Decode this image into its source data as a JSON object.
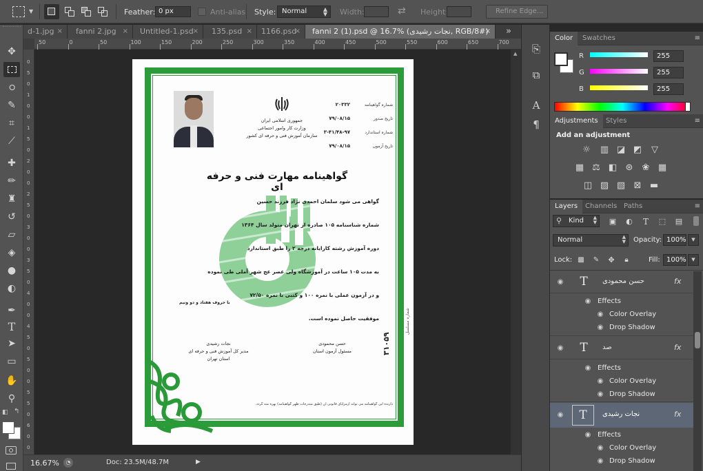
{
  "options": {
    "feather_label": "Feather:",
    "feather_value": "0 px",
    "antialias_label": "Anti-alias",
    "style_label": "Style:",
    "style_value": "Normal",
    "width_label": "Width:",
    "height_label": "Height:",
    "refine_label": "Refine Edge..."
  },
  "tabs": [
    {
      "label": "d-1.jpg"
    },
    {
      "label": "fanni 2.jpg"
    },
    {
      "label": "Untitled-1.psd"
    },
    {
      "label": "135.psd"
    },
    {
      "label": "1166.psd"
    },
    {
      "label": "fanni 2 (1).psd @ 16.7% (نجات رشیدی, RGB/8#)"
    }
  ],
  "tab_overflow": "»",
  "tab_close": "×",
  "ruler": {
    "h": [
      "50",
      "0",
      "50",
      "100",
      "150",
      "200",
      "250",
      "300",
      "350",
      "400",
      "450",
      "500",
      "550",
      "600",
      "650",
      "700"
    ],
    "v": [
      "0",
      "5",
      "0",
      "1",
      "0",
      "0",
      "1",
      "5",
      "0",
      "2",
      "0",
      "0",
      "2",
      "5",
      "0",
      "3",
      "0",
      "0",
      "3",
      "5",
      "0",
      "4",
      "0",
      "0",
      "4",
      "5",
      "0",
      "5",
      "0",
      "0",
      "5",
      "5",
      "0",
      "6",
      "0",
      "0"
    ]
  },
  "status": {
    "zoom": "16.67%",
    "doc": "Doc: 23.5M/48.7M"
  },
  "color_panel": {
    "tabs": [
      "Color",
      "Swatches"
    ],
    "channels": [
      {
        "label": "R",
        "value": "255"
      },
      {
        "label": "G",
        "value": "255"
      },
      {
        "label": "B",
        "value": "255"
      }
    ],
    "colors": {
      "r": "#ff0000",
      "g": "#00ff00",
      "b": "#0000ff"
    }
  },
  "adjustments_panel": {
    "tabs": [
      "Adjustments",
      "Styles"
    ],
    "heading": "Add an adjustment"
  },
  "layers_panel": {
    "tabs": [
      "Layers",
      "Channels",
      "Paths"
    ],
    "filter_label": "Kind",
    "blend_mode": "Normal",
    "opacity_label": "Opacity:",
    "opacity_value": "100%",
    "lock_label": "Lock:",
    "fill_label": "Fill:",
    "fill_value": "100%",
    "layers": [
      {
        "name": "حسن محمودی",
        "fx": "fx",
        "effects": "Effects",
        "effect1": "Color Overlay",
        "effect2": "Drop Shadow"
      },
      {
        "name": "صد",
        "fx": "fx",
        "effects": "Effects",
        "effect1": "Color Overlay",
        "effect2": "Drop Shadow"
      },
      {
        "name": "نجات رشیدی",
        "fx": "fx",
        "effects": "Effects",
        "effect1": "Color Overlay",
        "effect2": "Drop Shadow"
      }
    ]
  },
  "certificate": {
    "header_right": [
      "جمهوری اسلامی ایران",
      "وزارت کار وامور اجتماعی",
      "سازمان آموزش فنی و حرفه ای کشور"
    ],
    "meta_labels": [
      "شماره گواهینامه",
      "تاریخ صدور",
      "شماره استاندارد",
      "تاریخ آزمون"
    ],
    "meta_values": [
      "۲۰۳۳۲",
      "۷۹/۰۸/۱۵",
      "۳-۴۱/۴۸-۹۷",
      "۷۹/۰۸/۱۵"
    ],
    "title": "گواهینامه مهارت فنی و حرفه ای",
    "line1": "گواهی می شود     سلمان احمدی نژاد     فرزند     حسین",
    "line2": "شماره شناسنامه   ۱۰۵   صادره از   تهران   متولد سال   ۱۳۶۴",
    "line3": "دوره آموزش رشته   کارایانه درجه ۲   را طبق استاندارد",
    "line4": "به مدت  ۱۰۵  ساعت در  آموزشگاه  ولی عصر عج  شهر  آملی  طی نموده",
    "line5": "و در آزمون عملی با نمره  ۱۰۰  و کتبی با نمره  ۷۲/۵۰",
    "line5b": "با حروف  هفتاد و دو ونیم",
    "line6": "موفقیت حاصل نموده است.",
    "sign_left_name": "نجات رشیدی",
    "sign_left_title": "مدیر کل آموزش فنی و حرفه ای",
    "sign_left_place": "استان تهران",
    "sign_right_name": "حسن محمودی",
    "sign_right_title": "مسئول آزمون استان",
    "serial": "۳۱۰۵۹",
    "serial_label": "شماره مسلسل",
    "footer": "دارنده این گواهینامه می تواند ازمزایای قانونی آن (طبق مندرجات ظهر گواهینامه) بهره مند گردد."
  }
}
